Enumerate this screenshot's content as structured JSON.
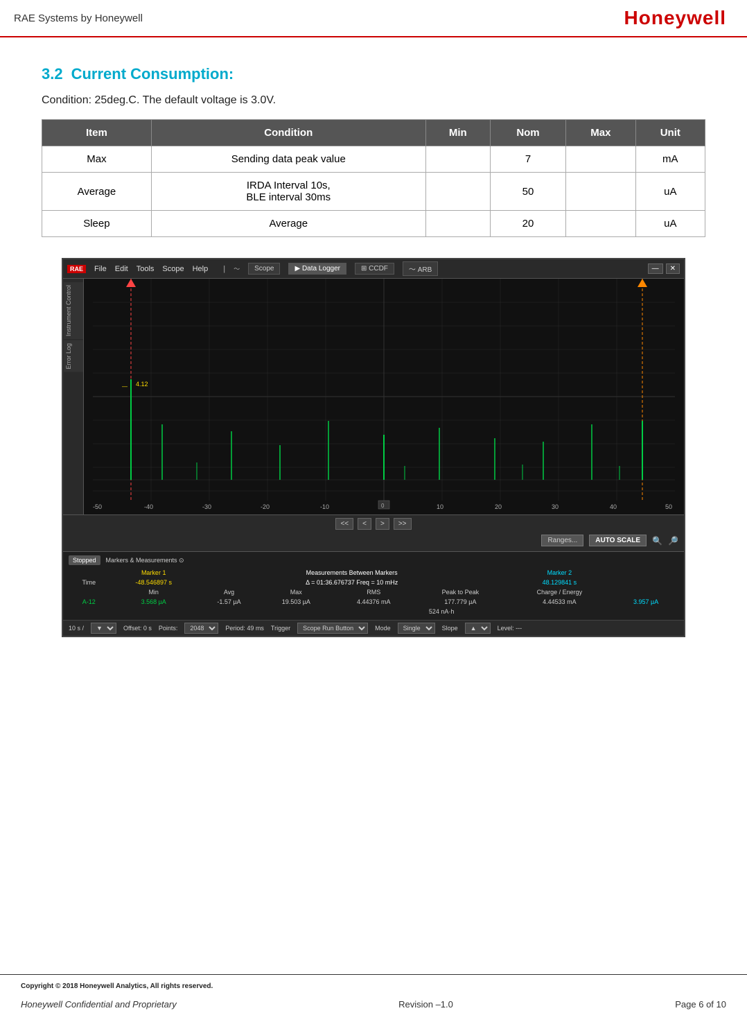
{
  "header": {
    "title": "RAE Systems by Honeywell",
    "logo": "Honeywell"
  },
  "section": {
    "number": "3.2",
    "title": "Current Consumption:"
  },
  "condition": "Condition: 25deg.C. The default voltage is 3.0V.",
  "table": {
    "headers": [
      "Item",
      "Condition",
      "Min",
      "Nom",
      "Max",
      "Unit"
    ],
    "rows": [
      {
        "item": "Max",
        "condition": "Sending data peak value",
        "min": "",
        "nom": "7",
        "max": "",
        "unit": "mA"
      },
      {
        "item": "Average",
        "condition": "IRDA Interval 10s,\nBLE interval 30ms",
        "min": "",
        "nom": "50",
        "max": "",
        "unit": "uA"
      },
      {
        "item": "Sleep",
        "condition": "Average",
        "min": "",
        "nom": "20",
        "max": "",
        "unit": "uA"
      }
    ]
  },
  "scope": {
    "menubar": {
      "logo": "RAE",
      "menus": [
        "File",
        "Edit",
        "Tools",
        "Scope",
        "Help"
      ],
      "tabs": [
        "Scope",
        "Data Logger",
        "CCDF",
        "ARB"
      ],
      "active_tab": "Data Logger"
    },
    "left_sidebar": [
      "Instrument Control",
      "Error Log"
    ],
    "display": {
      "x_labels": [
        "-50",
        "-40",
        "-30",
        "-20",
        "-10",
        "0",
        "10",
        "20",
        "30",
        "40",
        "50"
      ],
      "y_marker": "4.12",
      "dashed_lines": "vertical cursors at left and right"
    },
    "bottom": {
      "nav_buttons": [
        "<<",
        "<",
        ">",
        ">>"
      ],
      "controls": [
        "Ranges...",
        "AUTO SCALE"
      ]
    },
    "measurements": {
      "stopped_label": "Stopped",
      "markers_label": "Markers & Measurements",
      "marker1": {
        "label": "Marker 1",
        "time": "-48.546897 s",
        "a12": "3.568 µA"
      },
      "marker2": {
        "label": "Marker 2",
        "time": "48.129841 s"
      },
      "between": {
        "label": "Measurements Between Markers",
        "delta": "Δ = 01:36.676737  Freq = 10 mHz",
        "columns": [
          "Min",
          "Avg",
          "Max",
          "RMS",
          "Peak to Peak",
          "Charge / Energy"
        ],
        "values": [
          "-1.57 µA",
          "19.503 µA",
          "4.44376 mA",
          "177.779 µA",
          "4.44533 mA",
          "524 nA·h"
        ],
        "a12_values": [
          "3.957 µA"
        ]
      }
    },
    "statusbar": {
      "time": "10 s /",
      "offset": "Offset: 0 s",
      "points": "Points: 2048",
      "period": "Period: 49 ms",
      "trigger_label": "Trigger",
      "scope_run": "Scope Run Button",
      "mode_label": "Mode",
      "mode": "Single",
      "slope_label": "Slope",
      "slope": "▲",
      "level": "Level: ---"
    }
  },
  "footer": {
    "copyright": "Copyright © 2018 Honeywell Analytics, All rights reserved.",
    "confidential": "Honeywell Confidential and Proprietary",
    "revision": "Revision –1.0",
    "page": "Page 6 of 10"
  }
}
